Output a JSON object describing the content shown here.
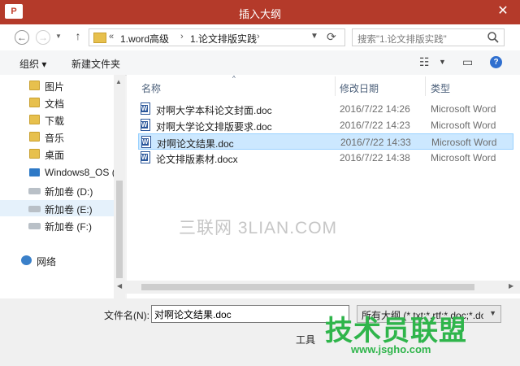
{
  "window": {
    "title": "插入大纲",
    "app_icon": "P",
    "close": "✕"
  },
  "address": {
    "overflow": "«",
    "crumbs": [
      "1.word高级",
      "1.论文排版实践"
    ],
    "separators": [
      "›",
      "›"
    ]
  },
  "search": {
    "placeholder": "搜索\"1.论文排版实践\""
  },
  "toolbar": {
    "organize": "组织 ▾",
    "new_folder": "新建文件夹"
  },
  "nav_pane": {
    "items": [
      {
        "label": "图片",
        "icon": "folder-icon"
      },
      {
        "label": "文档",
        "icon": "folder-icon"
      },
      {
        "label": "下载",
        "icon": "folder-icon"
      },
      {
        "label": "音乐",
        "icon": "folder-icon"
      },
      {
        "label": "桌面",
        "icon": "folder-icon"
      },
      {
        "label": "Windows8_OS (",
        "icon": "computer-icon"
      },
      {
        "label": "新加卷 (D:)",
        "icon": "drive-icon"
      },
      {
        "label": "新加卷 (E:)",
        "icon": "drive-icon"
      },
      {
        "label": "新加卷 (F:)",
        "icon": "drive-icon"
      },
      {
        "label": "网络",
        "icon": "network-icon"
      }
    ]
  },
  "file_list": {
    "columns": {
      "name": "名称",
      "date": "修改日期",
      "type": "类型"
    },
    "rows": [
      {
        "name": "对啊大学本科论文封面.doc",
        "date": "2016/7/22 14:26",
        "type": "Microsoft Word"
      },
      {
        "name": "对啊大学论文排版要求.doc",
        "date": "2016/7/22 14:23",
        "type": "Microsoft Word"
      },
      {
        "name": "对啊论文结果.doc",
        "date": "2016/7/22 14:33",
        "type": "Microsoft Word"
      },
      {
        "name": "论文排版素材.docx",
        "date": "2016/7/22 14:38",
        "type": "Microsoft Word"
      }
    ],
    "selected_index": 2
  },
  "watermark": "三联网 3LIAN.COM",
  "bottom": {
    "filename_label": "文件名(N):",
    "filename_value": "对啊论文结果.doc",
    "filetype_value": "所有大纲 (*.txt;*.rtf;*.doc;*.docx",
    "tools_label": "工具"
  },
  "logo": {
    "text": "技术员联盟",
    "url": "www.jsgho.com"
  },
  "colors": {
    "titlebar": "#b43a2a",
    "selection": "#cce8ff",
    "logo": "#2fb54b"
  }
}
